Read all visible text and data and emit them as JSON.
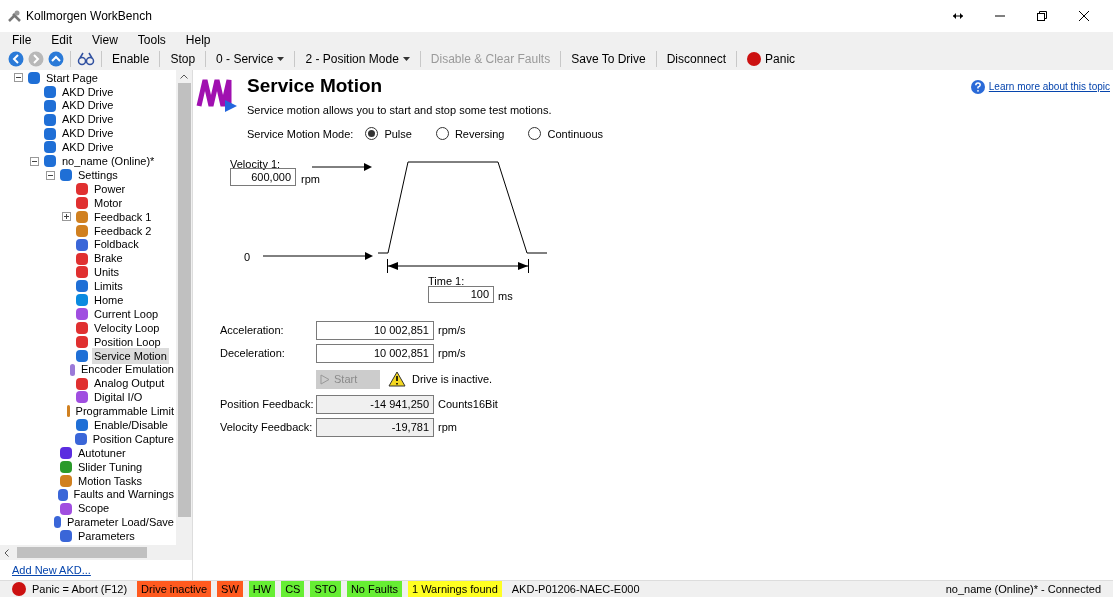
{
  "window": {
    "title": "Kollmorgen WorkBench"
  },
  "menu": [
    "File",
    "Edit",
    "View",
    "Tools",
    "Help"
  ],
  "toolbar": [
    {
      "kind": "back",
      "disabled": false
    },
    {
      "kind": "forward",
      "disabled": true
    },
    {
      "kind": "up",
      "disabled": false
    },
    {
      "kind": "view",
      "disabled": false
    },
    {
      "kind": "button",
      "label": "Enable",
      "disabled": false
    },
    {
      "kind": "button",
      "label": "Stop",
      "disabled": false
    },
    {
      "kind": "dropdown",
      "label": "0 - Service",
      "disabled": false
    },
    {
      "kind": "dropdown",
      "label": "2 - Position Mode",
      "disabled": false
    },
    {
      "kind": "button",
      "label": "Disable & Clear Faults",
      "disabled": true
    },
    {
      "kind": "button",
      "label": "Save To Drive",
      "disabled": false
    },
    {
      "kind": "button",
      "label": "Disconnect",
      "disabled": false
    },
    {
      "kind": "panic",
      "label": "Panic",
      "disabled": false
    }
  ],
  "tree": [
    {
      "label": "Start Page",
      "expanded": true,
      "selected": false,
      "children": [
        {
          "label": "AKD Drive",
          "selected": false
        },
        {
          "label": "AKD Drive",
          "selected": false
        },
        {
          "label": "AKD Drive",
          "selected": false
        },
        {
          "label": "AKD Drive",
          "selected": false
        },
        {
          "label": "AKD Drive",
          "selected": false
        },
        {
          "label": "no_name (Online)*",
          "expanded": true,
          "selected": false,
          "children": [
            {
              "label": "Settings",
              "expanded": true,
              "selected": false,
              "children": [
                {
                  "label": "Power",
                  "selected": false
                },
                {
                  "label": "Motor",
                  "selected": false
                },
                {
                  "label": "Feedback 1",
                  "expanded": false,
                  "selected": false
                },
                {
                  "label": "Feedback 2",
                  "selected": false
                },
                {
                  "label": "Foldback",
                  "selected": false
                },
                {
                  "label": "Brake",
                  "selected": false
                },
                {
                  "label": "Units",
                  "selected": false
                },
                {
                  "label": "Limits",
                  "selected": false
                },
                {
                  "label": "Home",
                  "selected": false
                },
                {
                  "label": "Current Loop",
                  "selected": false
                },
                {
                  "label": "Velocity Loop",
                  "selected": false
                },
                {
                  "label": "Position Loop",
                  "selected": false
                },
                {
                  "label": "Service Motion",
                  "selected": true
                },
                {
                  "label": "Encoder Emulation",
                  "selected": false
                },
                {
                  "label": "Analog Output",
                  "selected": false
                },
                {
                  "label": "Digital I/O",
                  "selected": false
                },
                {
                  "label": "Programmable Limit",
                  "selected": false
                },
                {
                  "label": "Enable/Disable",
                  "selected": false
                },
                {
                  "label": "Position Capture",
                  "selected": false
                }
              ]
            },
            {
              "label": "Autotuner",
              "selected": false
            },
            {
              "label": "Slider Tuning",
              "selected": false
            },
            {
              "label": "Motion Tasks",
              "selected": false
            },
            {
              "label": "Faults and Warnings",
              "selected": false
            },
            {
              "label": "Scope",
              "selected": false
            },
            {
              "label": "Parameter Load/Save",
              "selected": false
            },
            {
              "label": "Parameters",
              "selected": false
            }
          ]
        }
      ]
    }
  ],
  "add_link": "Add New AKD...",
  "page": {
    "title": "Service Motion",
    "description": "Service motion allows you to start and stop some test motions.",
    "help_link": "Learn more about this topic",
    "mode_label": "Service Motion Mode:",
    "modes": [
      {
        "label": "Pulse",
        "selected": true
      },
      {
        "label": "Reversing",
        "selected": false
      },
      {
        "label": "Continuous",
        "selected": false
      }
    ],
    "diagram": {
      "velocity_label": "Velocity 1:",
      "velocity_value": "600,000",
      "velocity_unit": "rpm",
      "zero_label": "0",
      "time_label": "Time 1:",
      "time_value": "100",
      "time_unit": "ms"
    },
    "fields": [
      {
        "label": "Acceleration:",
        "value": "10 002,851",
        "unit": "rpm/s",
        "readonly": false
      },
      {
        "label": "Deceleration:",
        "value": "10 002,851",
        "unit": "rpm/s",
        "readonly": false
      }
    ],
    "start_button": {
      "label": "Start",
      "disabled": true
    },
    "warning": "Drive is inactive.",
    "feedback": [
      {
        "label": "Position Feedback:",
        "value": "-14 941,250",
        "unit": "Counts16Bit",
        "readonly": true
      },
      {
        "label": "Velocity Feedback:",
        "value": "-19,781",
        "unit": "rpm",
        "readonly": true
      }
    ]
  },
  "status_bar": {
    "panic": "Panic = Abort (F12)",
    "flags": [
      {
        "label": "Drive inactive",
        "color": "#ff5a1f"
      },
      {
        "label": "SW",
        "color": "#ff5a1f"
      },
      {
        "label": "HW",
        "color": "#66ee33"
      },
      {
        "label": "CS",
        "color": "#66ee33"
      },
      {
        "label": "STO",
        "color": "#66ee33"
      },
      {
        "label": "No Faults",
        "color": "#66ee33"
      },
      {
        "label": "1 Warnings found",
        "color": "#ffff22"
      }
    ],
    "model": "AKD-P01206-NAEC-E000",
    "connection": "no_name (Online)* - Connected"
  }
}
